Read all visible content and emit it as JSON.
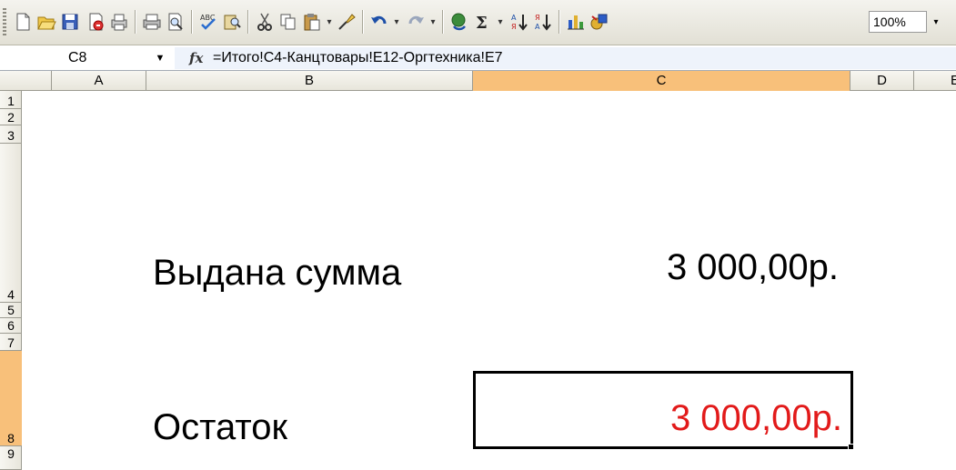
{
  "toolbar": {
    "zoom": "100%",
    "icons": [
      "new-icon",
      "open-icon",
      "save-icon",
      "permission-icon",
      "print-preview-icon",
      "print-icon",
      "preview-icon",
      "spelling-icon",
      "research-icon",
      "cut-icon",
      "copy-icon",
      "paste-icon",
      "format-painter-icon",
      "undo-icon",
      "redo-icon",
      "hyperlink-icon",
      "autosum-icon",
      "sort-ascending-icon",
      "sort-descending-icon",
      "chart-wizard-icon",
      "drawing-icon"
    ]
  },
  "formula_bar": {
    "name_box": "C8",
    "fx_symbol": "fx",
    "formula": "=Итого!C4-Канцтовары!E12-Оргтехника!E7"
  },
  "columns": [
    "A",
    "B",
    "C",
    "D",
    "E"
  ],
  "rows": [
    "1",
    "2",
    "3",
    "4",
    "5",
    "6",
    "7",
    "8",
    "9"
  ],
  "active_cell": {
    "column": "C",
    "row": "8"
  },
  "cells": {
    "B4": "Выдана сумма",
    "C4": "3 000,00р.",
    "B8": "Остаток",
    "C8": "3 000,00р."
  },
  "colors": {
    "active_header": "#f8c07a",
    "negative_value": "#e21a1a",
    "formula_area": "#eef3fb"
  }
}
